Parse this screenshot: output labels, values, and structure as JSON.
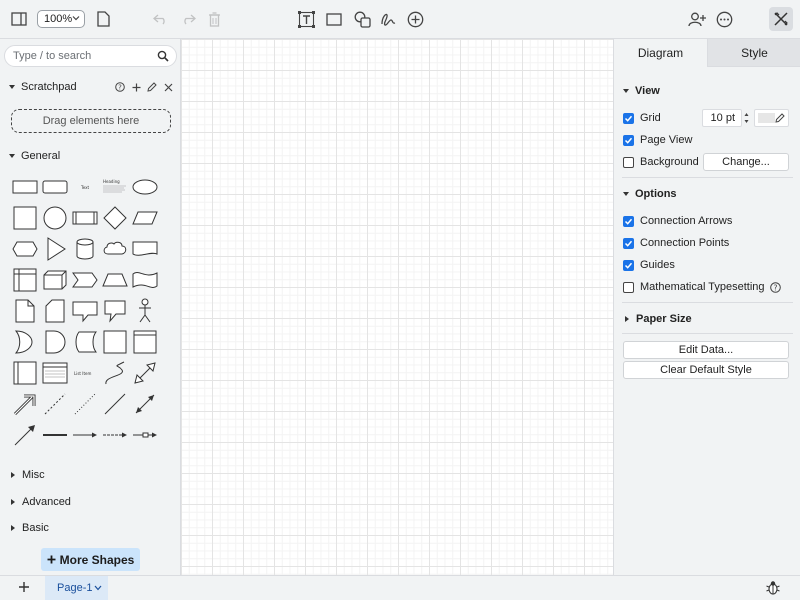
{
  "toolbar": {
    "zoom_value": "100%",
    "icons": [
      "sidebar-toggle-icon",
      "page-icon",
      "undo-icon",
      "redo-icon",
      "delete-icon",
      "text-icon",
      "rectangle-icon",
      "shapes-icon",
      "freehand-icon",
      "insert-icon",
      "share-icon",
      "more-icon",
      "format-panel-icon"
    ]
  },
  "sidebar": {
    "search_placeholder": "Type / to search",
    "scratchpad": {
      "title": "Scratchpad",
      "drop_hint": "Drag elements here"
    },
    "general": {
      "title": "General"
    },
    "collapsed_sections": [
      "Misc",
      "Advanced",
      "Basic"
    ],
    "more_shapes_label": "More Shapes",
    "shape_text": {
      "text": "Text",
      "heading": "Heading",
      "list_item": "List Item"
    }
  },
  "format_panel": {
    "tabs": [
      "Diagram",
      "Style"
    ],
    "view": {
      "title": "View",
      "grid": {
        "label": "Grid",
        "checked": true,
        "size": "10 pt"
      },
      "page_view": {
        "label": "Page View",
        "checked": true
      },
      "background": {
        "label": "Background",
        "checked": false,
        "button": "Change..."
      }
    },
    "options": {
      "title": "Options",
      "items": [
        {
          "label": "Connection Arrows",
          "checked": true
        },
        {
          "label": "Connection Points",
          "checked": true
        },
        {
          "label": "Guides",
          "checked": true
        },
        {
          "label": "Mathematical Typesetting",
          "checked": false
        }
      ]
    },
    "paper_size": {
      "title": "Paper Size"
    },
    "buttons": {
      "edit_data": "Edit Data...",
      "clear_style": "Clear Default Style"
    }
  },
  "footer": {
    "page_tab": "Page-1"
  },
  "colors": {
    "accent": "#1a73e8",
    "chrome": "#f1f3f4",
    "border": "#dadce0",
    "more_shapes_bg": "#cbe4fb",
    "page_tab_bg": "#dce9f7"
  }
}
